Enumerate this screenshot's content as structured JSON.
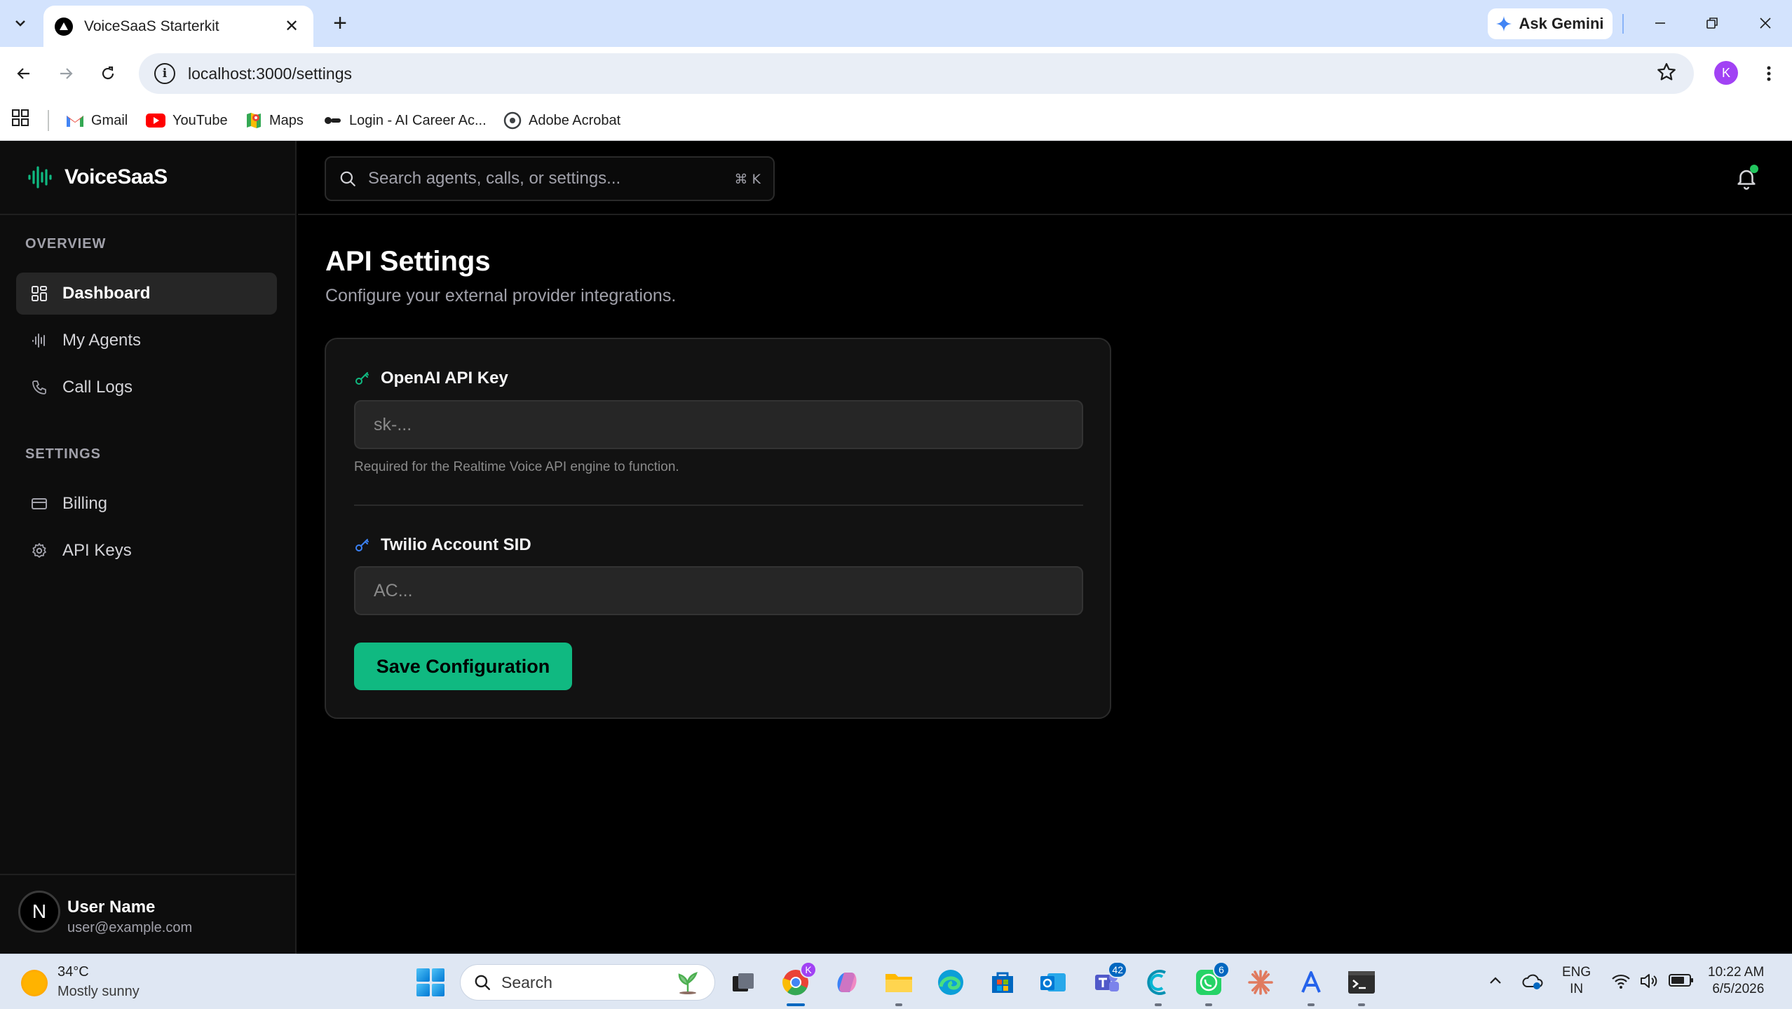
{
  "browser": {
    "tab_title": "VoiceSaaS Starterkit",
    "tab_close": "✕",
    "new_tab": "+",
    "gemini_label": "Ask Gemini",
    "url": "localhost:3000/settings",
    "profile_initial": "K",
    "bookmarks": [
      {
        "label": "Gmail",
        "icon": "gmail-icon"
      },
      {
        "label": "YouTube",
        "icon": "youtube-icon"
      },
      {
        "label": "Maps",
        "icon": "maps-icon"
      },
      {
        "label": "Login - AI Career Ac...",
        "icon": "career-icon"
      },
      {
        "label": "Adobe Acrobat",
        "icon": "acrobat-icon"
      }
    ]
  },
  "app": {
    "brand": "VoiceSaaS",
    "accent_color": "#10b981",
    "search": {
      "placeholder": "Search agents, calls, or settings...",
      "shortcut": "⌘ K"
    },
    "sidebar": {
      "overview_heading": "OVERVIEW",
      "settings_heading": "SETTINGS",
      "overview_items": [
        {
          "label": "Dashboard",
          "icon": "dashboard-grid-icon",
          "active": true
        },
        {
          "label": "My Agents",
          "icon": "waveform-icon",
          "active": false
        },
        {
          "label": "Call Logs",
          "icon": "phone-icon",
          "active": false
        }
      ],
      "settings_items": [
        {
          "label": "Billing",
          "icon": "credit-card-icon",
          "active": false
        },
        {
          "label": "API Keys",
          "icon": "gear-icon",
          "active": false
        }
      ]
    },
    "user": {
      "initial": "N",
      "name": "User Name",
      "email": "user@example.com"
    },
    "page": {
      "title": "API Settings",
      "subtitle": "Configure your external provider integrations."
    },
    "form": {
      "openai_label": "OpenAI API Key",
      "openai_placeholder": "sk-...",
      "openai_help": "Required for the Realtime Voice API engine to function.",
      "twilio_label": "Twilio Account SID",
      "twilio_placeholder": "AC...",
      "save_label": "Save Configuration"
    }
  },
  "taskbar": {
    "weather_temp": "34°C",
    "weather_desc": "Mostly sunny",
    "search_label": "Search",
    "badges": {
      "teams": "42",
      "whatsapp": "6",
      "chrome": "K"
    },
    "lang_top": "ENG",
    "lang_bottom": "IN",
    "time": "10:22 AM",
    "date": "6/5/2026"
  }
}
